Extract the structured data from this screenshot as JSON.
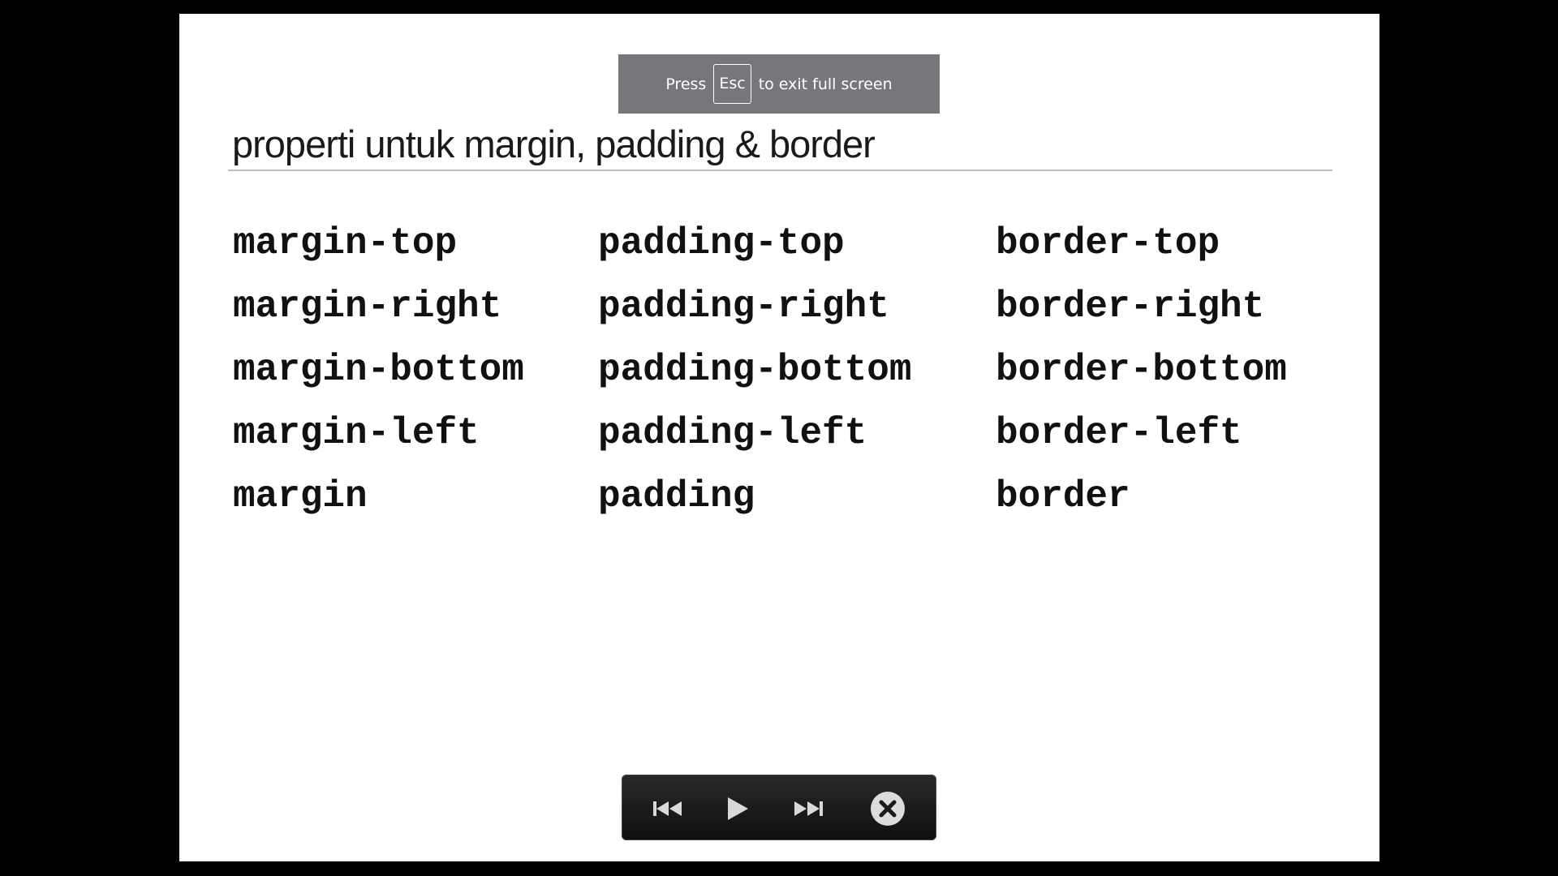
{
  "slide": {
    "title": "properti untuk margin, padding & border",
    "columns": [
      {
        "name": "margin",
        "items": [
          "margin-top",
          "margin-right",
          "margin-bottom",
          "margin-left",
          "margin"
        ]
      },
      {
        "name": "padding",
        "items": [
          "padding-top",
          "padding-right",
          "padding-bottom",
          "padding-left",
          "padding"
        ]
      },
      {
        "name": "border",
        "items": [
          "border-top",
          "border-right",
          "border-bottom",
          "border-left",
          "border"
        ]
      }
    ]
  },
  "fullscreen_notice": {
    "before": "Press",
    "key": "Esc",
    "after": "to exit full screen"
  },
  "controls": {
    "icons": [
      "skip-back-icon",
      "play-icon",
      "skip-forward-icon",
      "close-icon"
    ]
  },
  "colors": {
    "background": "#000000",
    "slide": "#ffffff",
    "toast": "#76777b",
    "controls": "#1a1a1a"
  }
}
